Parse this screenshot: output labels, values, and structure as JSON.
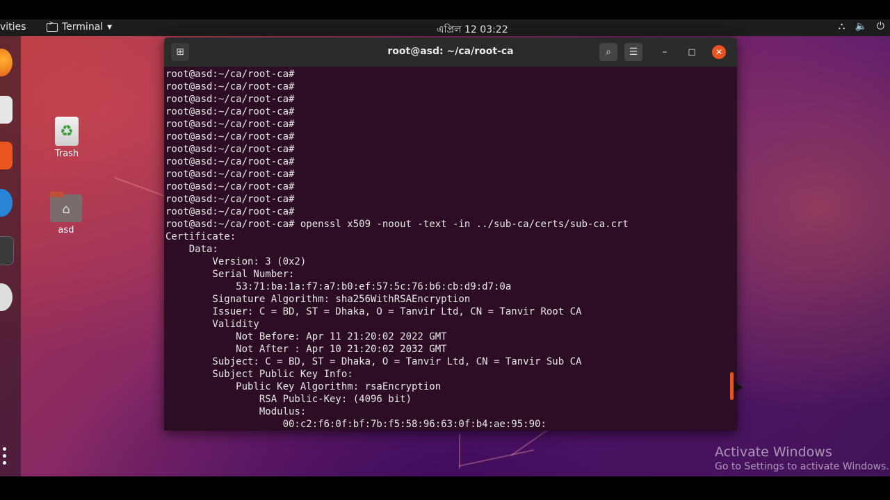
{
  "top_panel": {
    "activities": "vities",
    "app_menu": "Terminal",
    "app_menu_arrow": "▾",
    "clock": "এপ্রিল 12  03:22",
    "icons": [
      "network-icon",
      "volume-icon",
      "power-icon"
    ]
  },
  "desktop": {
    "icons": [
      {
        "label": "Trash",
        "icon": "trash-icon"
      },
      {
        "label": "asd",
        "icon": "home-folder-icon"
      }
    ]
  },
  "terminal": {
    "title": "root@asd: ~/ca/root-ca",
    "lines": [
      "root@asd:~/ca/root-ca#",
      "root@asd:~/ca/root-ca#",
      "root@asd:~/ca/root-ca#",
      "root@asd:~/ca/root-ca#",
      "root@asd:~/ca/root-ca#",
      "root@asd:~/ca/root-ca#",
      "root@asd:~/ca/root-ca#",
      "root@asd:~/ca/root-ca#",
      "root@asd:~/ca/root-ca#",
      "root@asd:~/ca/root-ca#",
      "root@asd:~/ca/root-ca#",
      "root@asd:~/ca/root-ca#",
      "root@asd:~/ca/root-ca# openssl x509 -noout -text -in ../sub-ca/certs/sub-ca.crt",
      "Certificate:",
      "    Data:",
      "        Version: 3 (0x2)",
      "        Serial Number:",
      "            53:71:ba:1a:f7:a7:b0:ef:57:5c:76:b6:cb:d9:d7:0a",
      "        Signature Algorithm: sha256WithRSAEncryption",
      "        Issuer: C = BD, ST = Dhaka, O = Tanvir Ltd, CN = Tanvir Root CA",
      "        Validity",
      "            Not Before: Apr 11 21:20:02 2022 GMT",
      "            Not After : Apr 10 21:20:02 2032 GMT",
      "        Subject: C = BD, ST = Dhaka, O = Tanvir Ltd, CN = Tanvir Sub CA",
      "        Subject Public Key Info:",
      "            Public Key Algorithm: rsaEncryption",
      "                RSA Public-Key: (4096 bit)",
      "                Modulus:",
      "                    00:c2:f6:0f:bf:7b:f5:58:96:63:0f:b4:ae:95:90:"
    ]
  },
  "watermark": {
    "title": "Activate Windows",
    "subtitle": "Go to Settings to activate Windows."
  },
  "colors": {
    "terminal_bg": "#2c0d24",
    "accent": "#e95420"
  }
}
